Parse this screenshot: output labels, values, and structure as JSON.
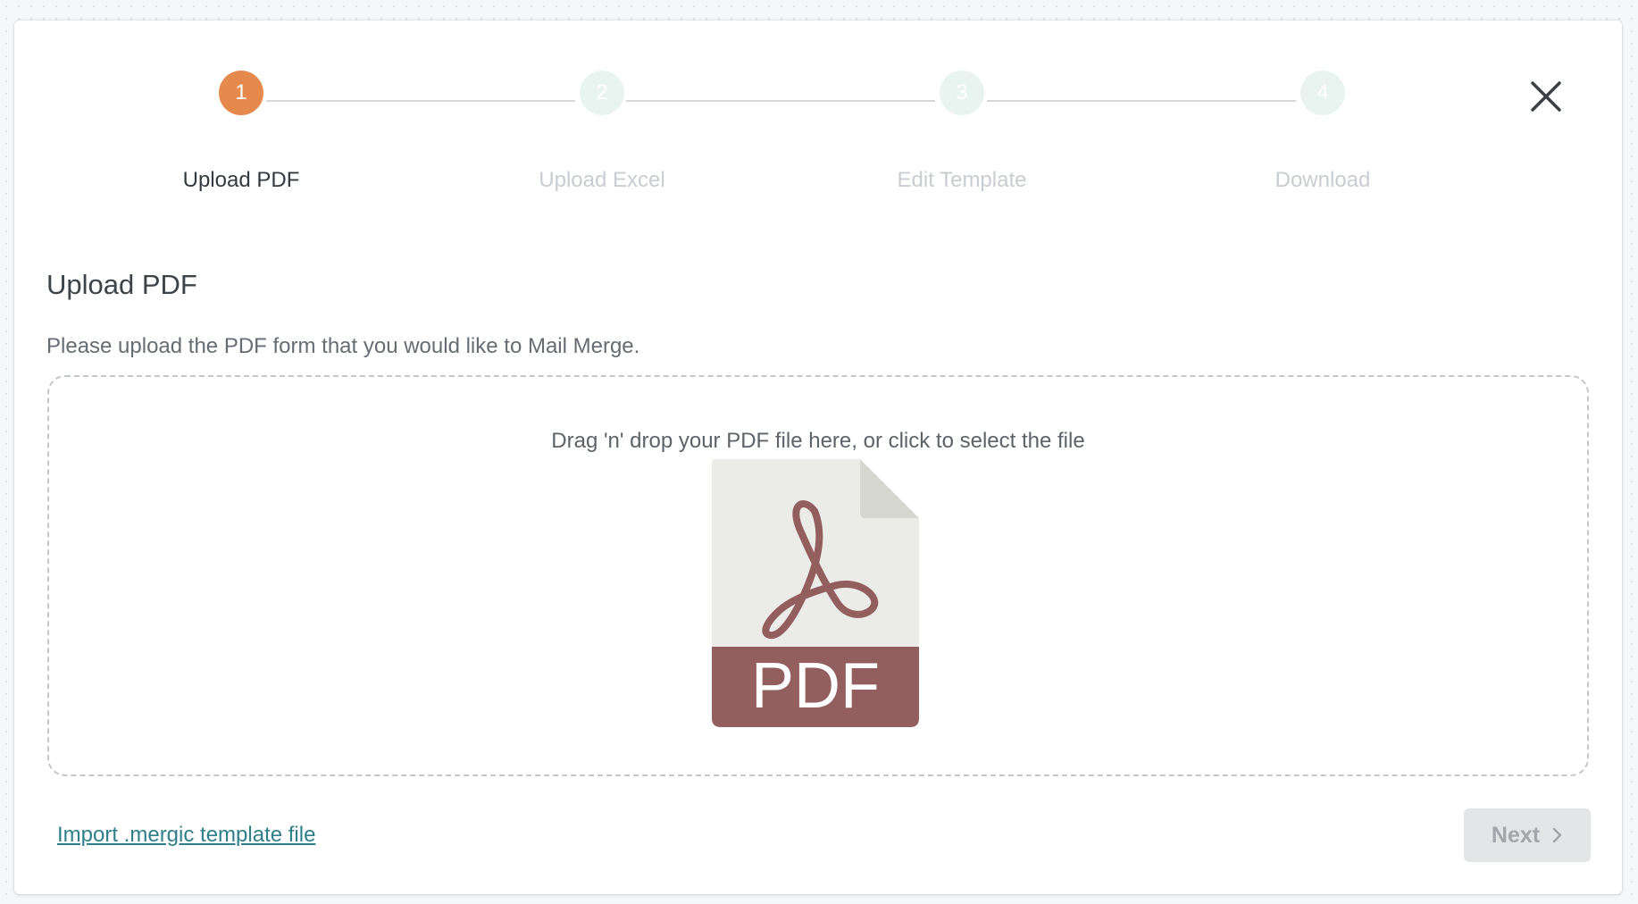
{
  "stepper": {
    "steps": [
      {
        "number": "1",
        "label": "Upload PDF",
        "state": "active"
      },
      {
        "number": "2",
        "label": "Upload Excel",
        "state": "inactive"
      },
      {
        "number": "3",
        "label": "Edit Template",
        "state": "inactive"
      },
      {
        "number": "4",
        "label": "Download",
        "state": "inactive"
      }
    ]
  },
  "icons": {
    "close": "close-icon",
    "pdf": "pdf-file-icon",
    "next": "chevron-right-icon"
  },
  "pdf_icon": {
    "label": "PDF"
  },
  "main": {
    "title": "Upload PDF",
    "description": "Please upload the PDF form that you would like to Mail Merge.",
    "dropzone_text": "Drag 'n' drop your PDF file here, or click to select the file"
  },
  "footer": {
    "import_link": "Import .mergic template file",
    "next_label": "Next"
  },
  "colors": {
    "active_step": "#e58a4c",
    "inactive_step": "#e9f4f1",
    "link": "#2f7f8a",
    "pdf_band": "#935f5e"
  }
}
